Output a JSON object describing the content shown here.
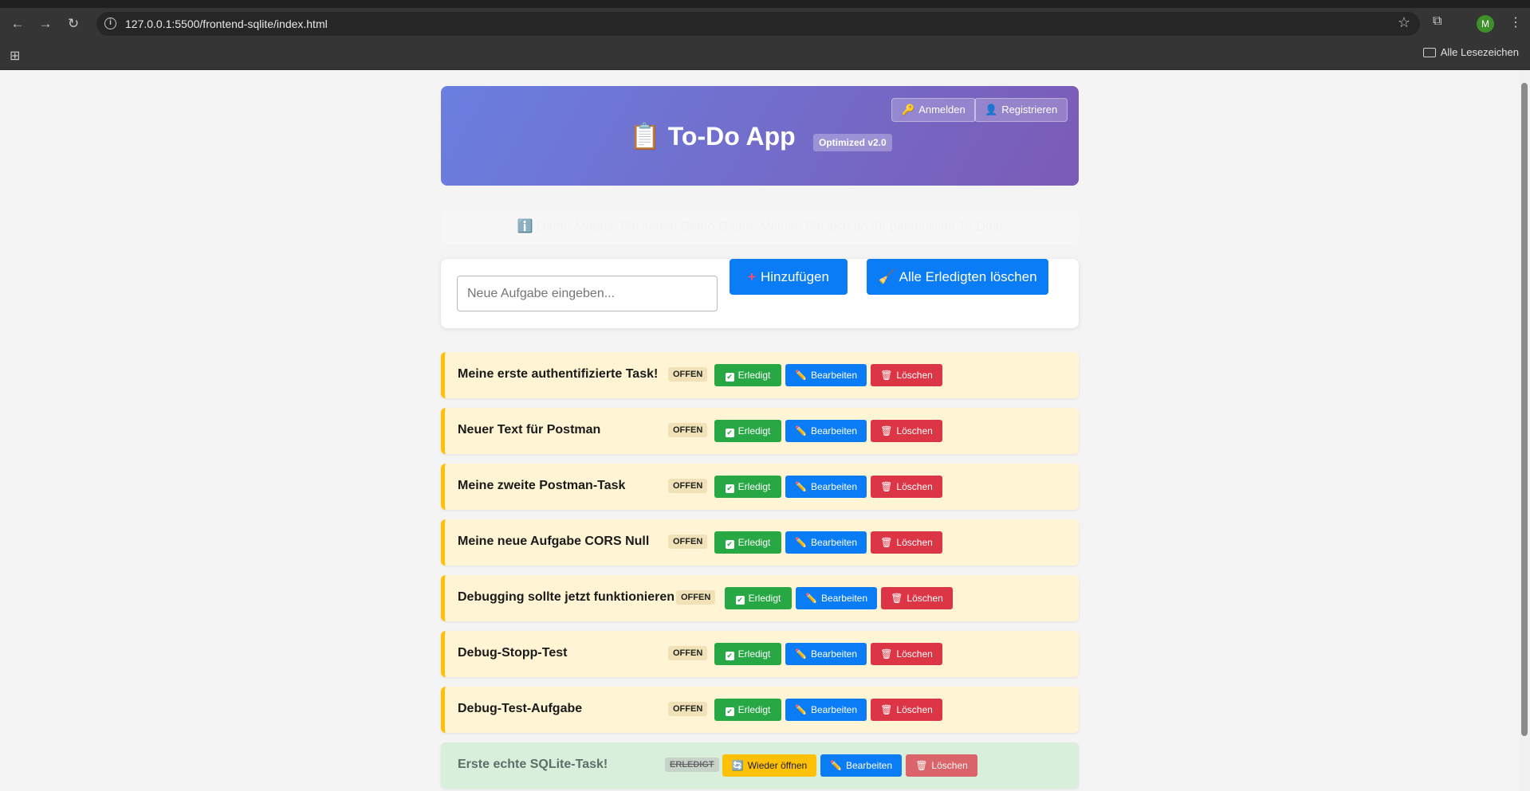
{
  "browser": {
    "url": "127.0.0.1:5500/frontend-sqlite/index.html",
    "profile_initial": "M",
    "bookmarks_label": "Alle Lesezeichen"
  },
  "header": {
    "login_label": "Anmelden",
    "register_label": "Registrieren",
    "title": "To-Do App",
    "version_badge": "Optimized v2.0",
    "title_icon": "clipboard-icon"
  },
  "demo_notice": "Demo-Modus: Sie sehen Demo-Daten. Melden Sie sich an für persönliche To-Dos!",
  "add_form": {
    "placeholder": "Neue Aufgabe eingeben...",
    "add_label": "Hinzufügen",
    "clear_done_label": "Alle Erledigten löschen"
  },
  "tasks": [
    {
      "title": "Meine erste authentifizierte Task!",
      "status": "OFFEN",
      "done": false
    },
    {
      "title": "Neuer Text für Postman",
      "status": "OFFEN",
      "done": false
    },
    {
      "title": "Meine zweite Postman-Task",
      "status": "OFFEN",
      "done": false
    },
    {
      "title": "Meine neue Aufgabe CORS Null",
      "status": "OFFEN",
      "done": false
    },
    {
      "title": "Debugging sollte jetzt funktionieren",
      "status": "OFFEN",
      "done": false
    },
    {
      "title": "Debug-Stopp-Test",
      "status": "OFFEN",
      "done": false
    },
    {
      "title": "Debug-Test-Aufgabe",
      "status": "OFFEN",
      "done": false
    },
    {
      "title": "Erste echte SQLite-Task!",
      "status": "ERLEDIGT",
      "done": true
    }
  ],
  "actions": {
    "done_label": "Erledigt",
    "edit_label": "Bearbeiten",
    "delete_label": "Löschen",
    "reopen_label": "Wieder öffnen"
  },
  "colors": {
    "header_gradient_start": "#6a7fe0",
    "header_gradient_end": "#7b5bb6",
    "open_task_bg": "#fff4d3",
    "open_task_border": "#ffc107",
    "done_task_bg": "#d8efdc",
    "primary": "#0a7cf5",
    "success": "#28a745",
    "danger": "#dc3545",
    "warning": "#ffc107"
  }
}
